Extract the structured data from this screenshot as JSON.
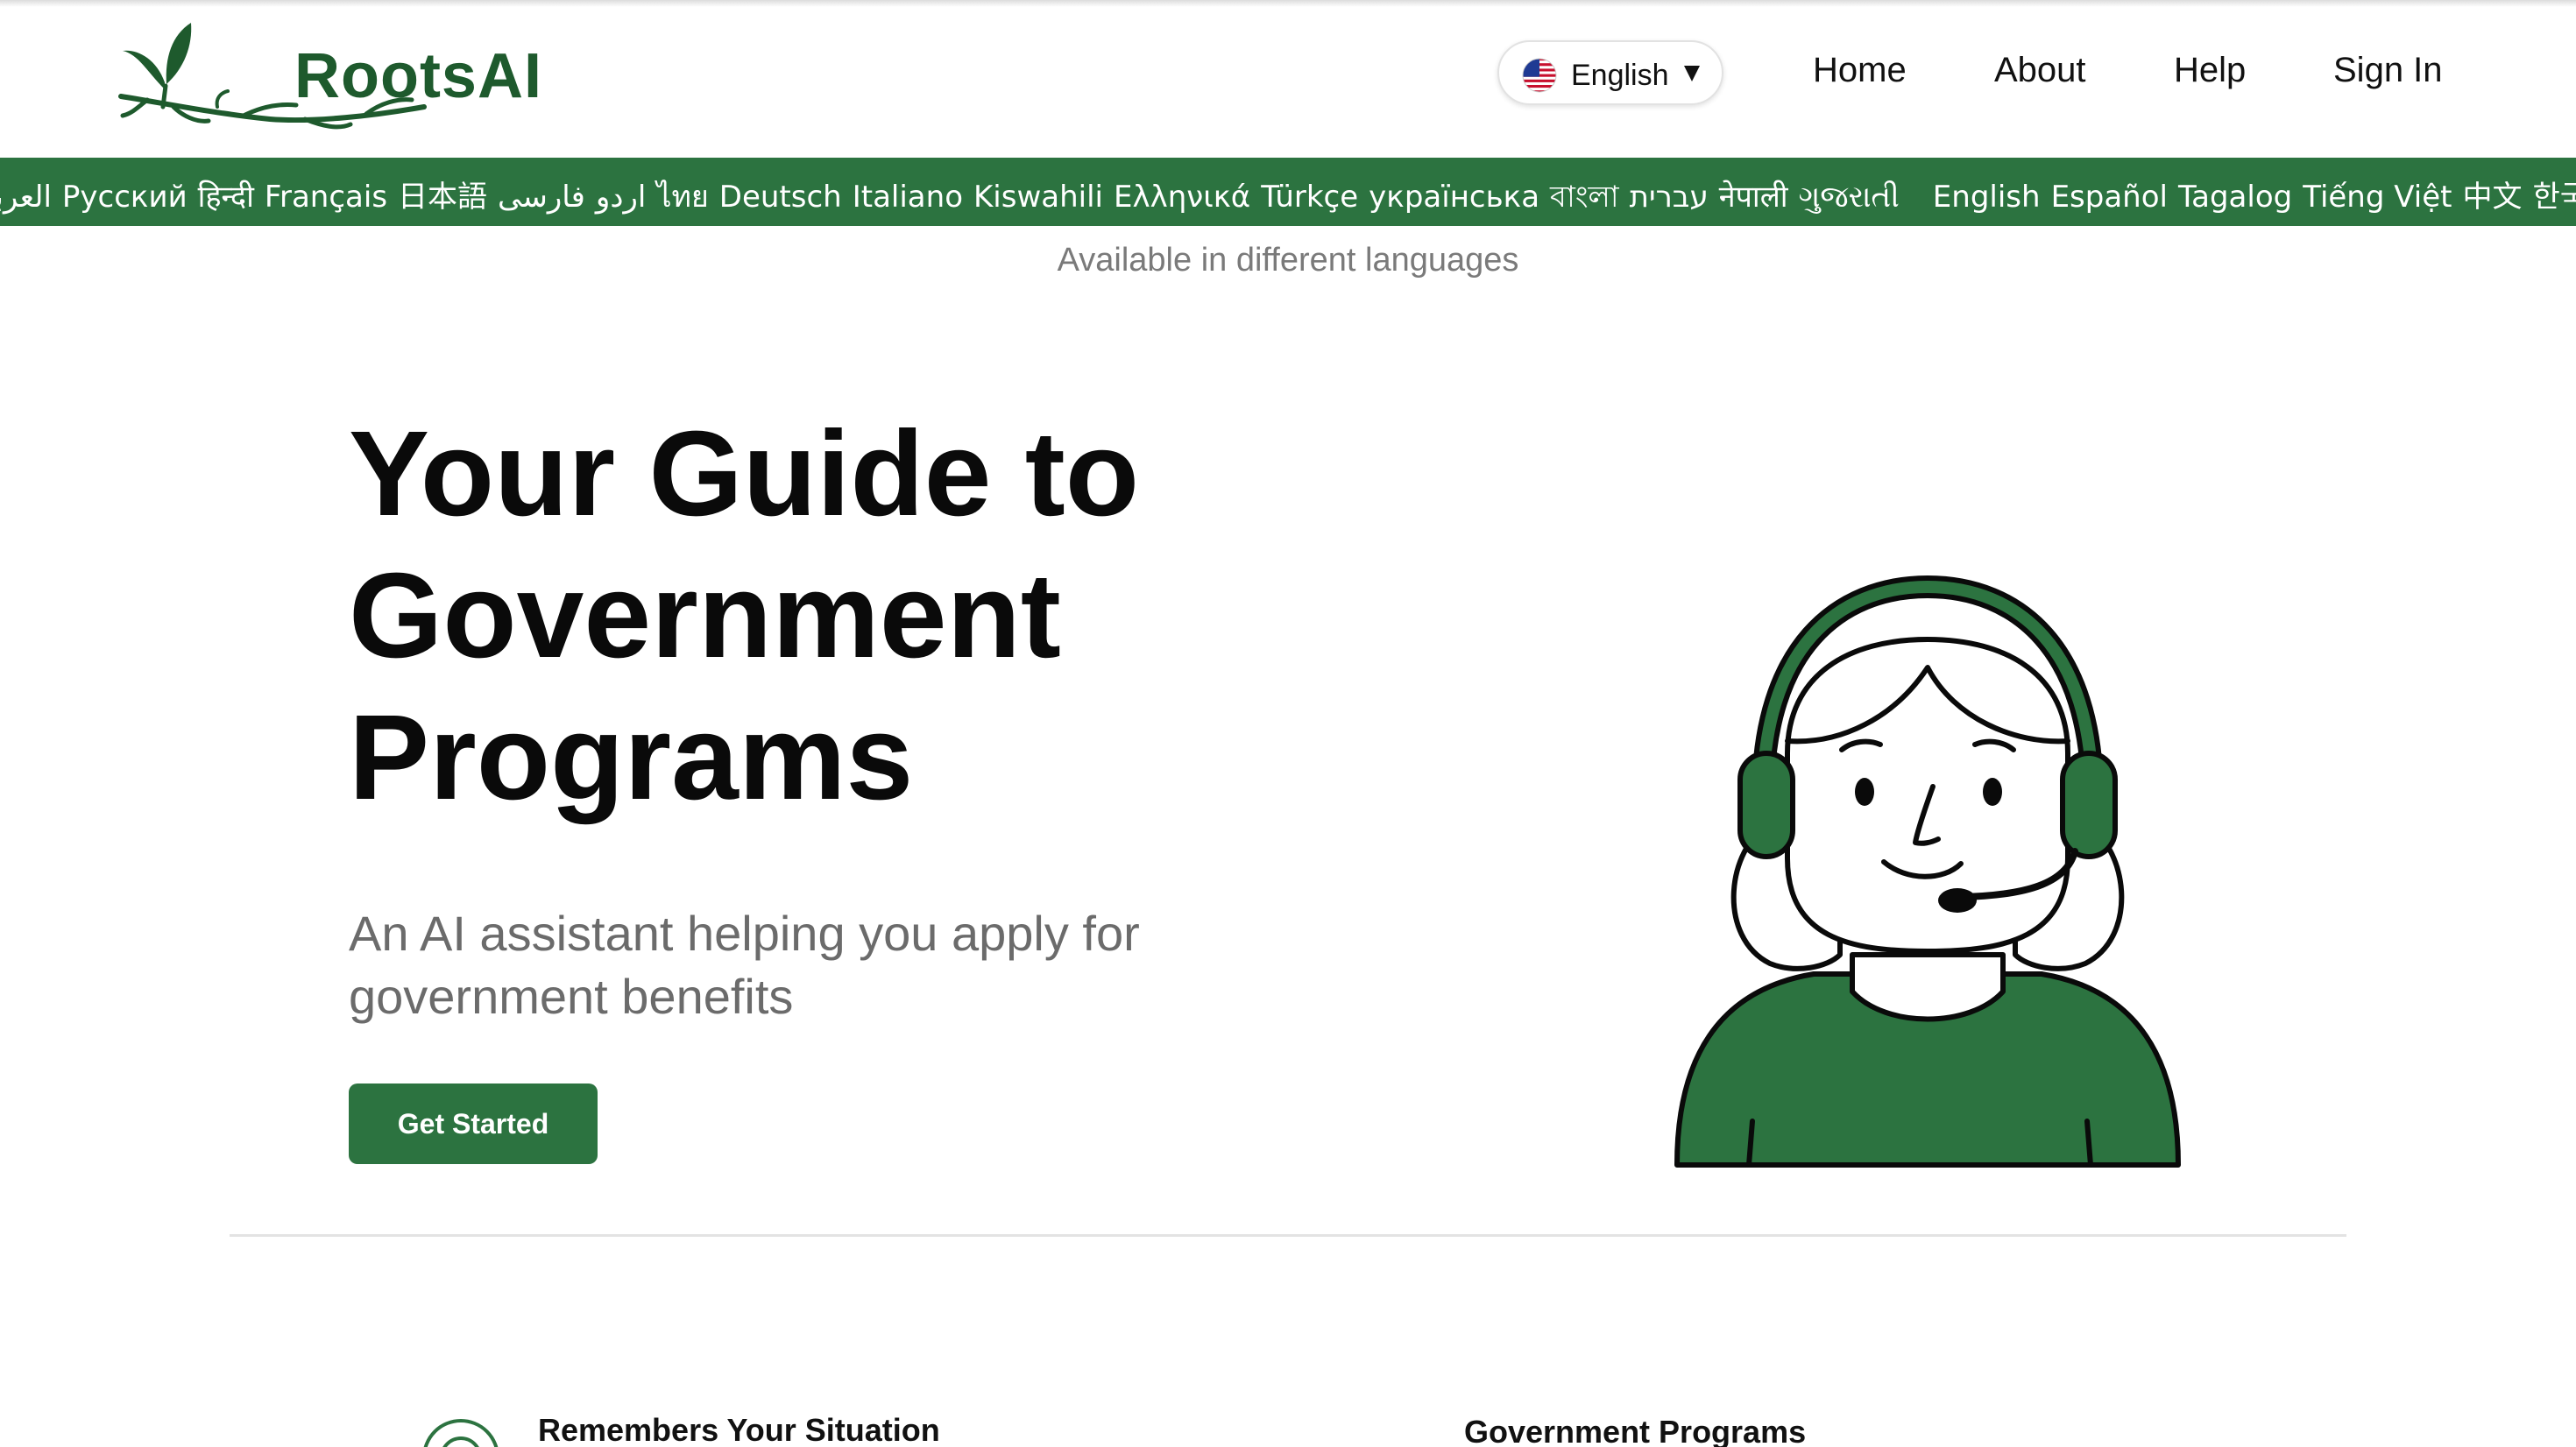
{
  "brand": {
    "name": "RootsAI",
    "color": "#1e5a2d"
  },
  "header": {
    "language_select": {
      "value": "English",
      "flag_icon": "us-flag-icon",
      "caret_icon": "caret-down-icon"
    },
    "nav": [
      {
        "label": "Home"
      },
      {
        "label": "About"
      },
      {
        "label": "Help"
      },
      {
        "label": "Sign In"
      }
    ]
  },
  "language_banner": {
    "languages": [
      "العربية",
      "Русский",
      "हिन्दी",
      "Français",
      "日本語",
      "اردو",
      "فارسی",
      "ไทย",
      "Deutsch",
      "Italiano",
      "Kiswahili",
      "Ελληνικά",
      "Türkçe",
      "українська",
      "বাংলা",
      "עברית",
      "नेपाली",
      "ગુજરાતી",
      "English",
      "Español",
      "Tagalog",
      "Tiếng Việt",
      "中文",
      "한국어",
      "العربية",
      "Русский",
      "हिन्दी",
      "Français"
    ],
    "background": "#2c7340",
    "caption": "Available in different languages"
  },
  "hero": {
    "title_lines": [
      "Your Guide to",
      "Government",
      "Programs"
    ],
    "subtitle": "An AI assistant helping you apply for government benefits",
    "cta_label": "Get Started",
    "illustration": "support-agent-headset-illustration",
    "accent": "#2c7340"
  },
  "features": [
    {
      "title": "Remembers Your Situation",
      "icon": "target-icon"
    },
    {
      "title": "Government Programs"
    }
  ]
}
